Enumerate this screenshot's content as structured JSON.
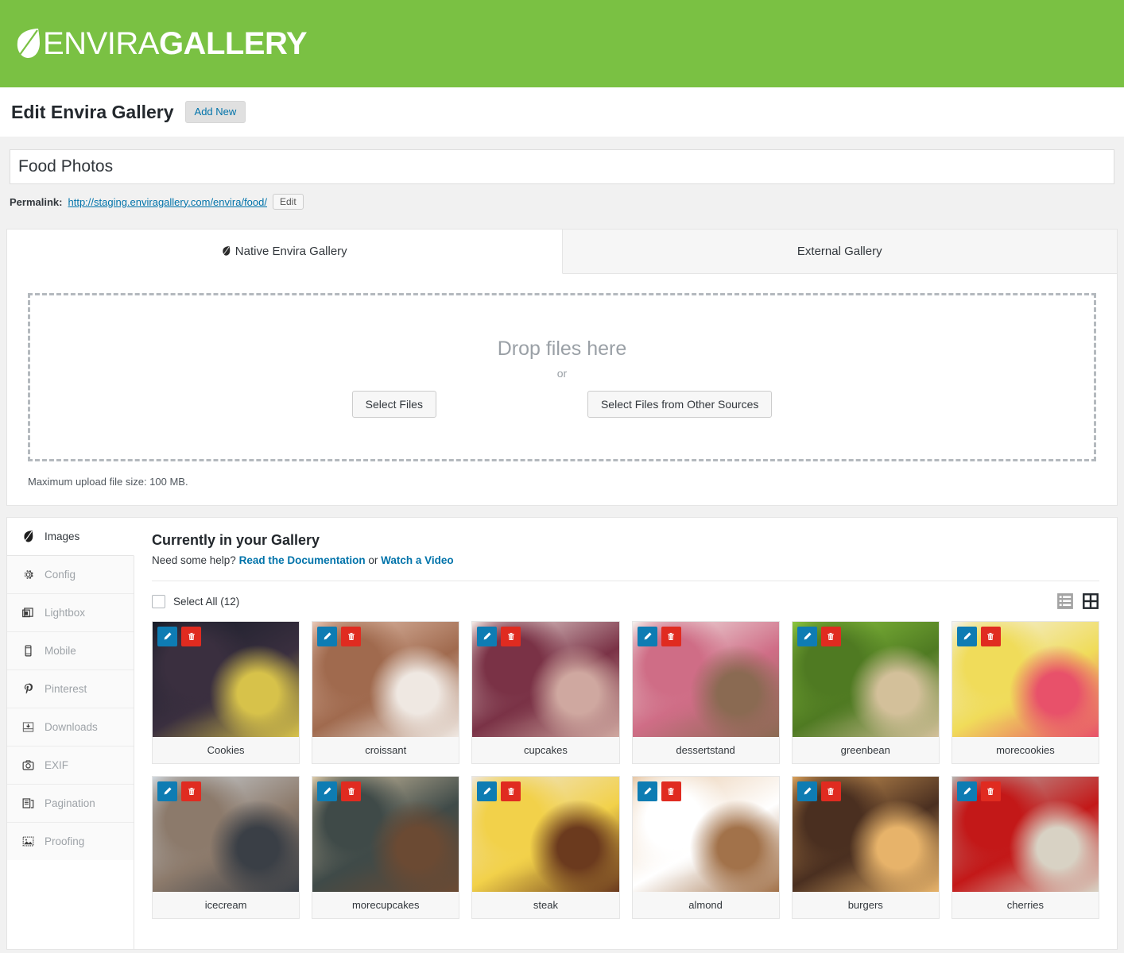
{
  "brand": {
    "name_light": "ENVIRA",
    "name_bold": "GALLERY",
    "leaf_icon": "leaf-icon",
    "green": "#7ac143"
  },
  "titlebar": {
    "title": "Edit Envira Gallery",
    "add_new_label": "Add New"
  },
  "post": {
    "gallery_title": "Food Photos",
    "title_placeholder": "Enter title here",
    "permalink_label": "Permalink:",
    "permalink_url": "http://staging.enviragallery.com/envira/food/",
    "edit_slug_label": "Edit"
  },
  "uploader": {
    "tabs": [
      {
        "label": "Native Envira Gallery",
        "icon": "leaf-icon",
        "active": true
      },
      {
        "label": "External Gallery",
        "icon": null,
        "active": false
      }
    ],
    "drop_title": "Drop files here",
    "or_label": "or",
    "select_files_label": "Select Files",
    "other_sources_label": "Select Files from Other Sources",
    "max_size_note": "Maximum upload file size: 100 MB."
  },
  "sidebar": {
    "items": [
      {
        "label": "Images",
        "icon": "leaf-icon",
        "active": true
      },
      {
        "label": "Config",
        "icon": "gear-icon",
        "active": false
      },
      {
        "label": "Lightbox",
        "icon": "layers-icon",
        "active": false
      },
      {
        "label": "Mobile",
        "icon": "phone-icon",
        "active": false
      },
      {
        "label": "Pinterest",
        "icon": "pinterest-icon",
        "active": false
      },
      {
        "label": "Downloads",
        "icon": "download-icon",
        "active": false
      },
      {
        "label": "EXIF",
        "icon": "camera-icon",
        "active": false
      },
      {
        "label": "Pagination",
        "icon": "pagination-icon",
        "active": false
      },
      {
        "label": "Proofing",
        "icon": "image-icon",
        "active": false
      }
    ]
  },
  "gallery": {
    "heading": "Currently in your Gallery",
    "help_prefix": "Need some help? ",
    "help_link1": "Read the Documentation",
    "help_mid": " or ",
    "help_link2": "Watch a Video",
    "select_all_label": "Select All (12)",
    "view_list_icon": "list-view-icon",
    "view_grid_icon": "grid-view-icon",
    "active_view": "grid",
    "edit_icon": "pencil-icon",
    "delete_icon": "trash-icon",
    "items": [
      {
        "label": "Cookies",
        "c1": "#151c28",
        "c2": "#3a2f3f",
        "c3": "#d7c24a"
      },
      {
        "label": "croissant",
        "c1": "#e7c6b4",
        "c2": "#a06a4e",
        "c3": "#efe8e2"
      },
      {
        "label": "cupcakes",
        "c1": "#f2e7e2",
        "c2": "#7a3246",
        "c3": "#cfa8a0"
      },
      {
        "label": "dessertstand",
        "c1": "#f3eeea",
        "c2": "#cf6d86",
        "c3": "#8a6a52"
      },
      {
        "label": "greenbean",
        "c1": "#8cc63f",
        "c2": "#4f7a22",
        "c3": "#d3c09a"
      },
      {
        "label": "morecookies",
        "c1": "#f4f2ee",
        "c2": "#f0dc5a",
        "c3": "#e8516a"
      },
      {
        "label": "icecream",
        "c1": "#cfd6dc",
        "c2": "#8c7a6b",
        "c3": "#3a3f46"
      },
      {
        "label": "morecupcakes",
        "c1": "#dbc9a8",
        "c2": "#3f4a48",
        "c3": "#6b4a33"
      },
      {
        "label": "steak",
        "c1": "#efe6d8",
        "c2": "#f2d14a",
        "c3": "#6b3a1e"
      },
      {
        "label": "almond",
        "c1": "#e8c9a8",
        "c2": "#ffffff",
        "c3": "#a2724a"
      },
      {
        "label": "burgers",
        "c1": "#d9a05a",
        "c2": "#4a2f20",
        "c3": "#e7b36a"
      },
      {
        "label": "cherries",
        "c1": "#b9b2ae",
        "c2": "#c31818",
        "c3": "#d8d2c4"
      }
    ]
  }
}
